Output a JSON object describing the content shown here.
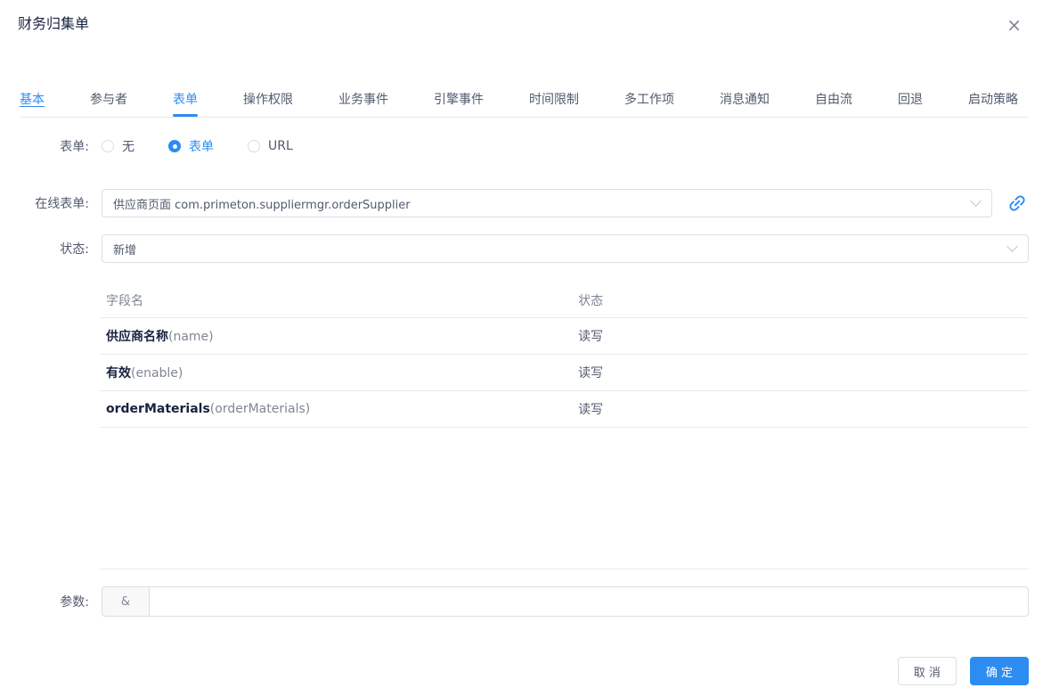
{
  "modal": {
    "title": "财务归集单"
  },
  "icons": {
    "close": "×",
    "chevron": "chevron-down",
    "link": "link-chain"
  },
  "tabs": [
    {
      "label": "基本",
      "style": "link"
    },
    {
      "label": "参与者",
      "style": "normal"
    },
    {
      "label": "表单",
      "style": "active"
    },
    {
      "label": "操作权限",
      "style": "normal"
    },
    {
      "label": "业务事件",
      "style": "normal"
    },
    {
      "label": "引擎事件",
      "style": "normal"
    },
    {
      "label": "时间限制",
      "style": "normal"
    },
    {
      "label": "多工作项",
      "style": "normal"
    },
    {
      "label": "消息通知",
      "style": "normal"
    },
    {
      "label": "自由流",
      "style": "normal"
    },
    {
      "label": "回退",
      "style": "normal"
    },
    {
      "label": "启动策略",
      "style": "normal"
    }
  ],
  "form": {
    "form_type": {
      "label": "表单:",
      "options": [
        {
          "label": "无",
          "selected": false
        },
        {
          "label": "表单",
          "selected": true
        },
        {
          "label": "URL",
          "selected": false
        }
      ]
    },
    "online_form": {
      "label": "在线表单:",
      "value": "供应商页面 com.primeton.suppliermgr.orderSupplier"
    },
    "status": {
      "label": "状态:",
      "value": "新增"
    },
    "params": {
      "label": "参数:",
      "prefix": "&",
      "value": ""
    }
  },
  "fields_table": {
    "columns": [
      "字段名",
      "状态"
    ],
    "rows": [
      {
        "field": "供应商名称",
        "code": "(name)",
        "status": "读写"
      },
      {
        "field": "有效",
        "code": "(enable)",
        "status": "读写"
      },
      {
        "field": "orderMaterials",
        "code": "(orderMaterials)",
        "status": "读写"
      }
    ]
  },
  "footer": {
    "cancel": "取 消",
    "confirm": "确 定"
  },
  "colors": {
    "primary": "#2d8cf0",
    "border": "#dcdee2",
    "divider": "#e8eaec",
    "text": "#515a6e",
    "text_dark": "#17233d",
    "muted": "#808695"
  }
}
